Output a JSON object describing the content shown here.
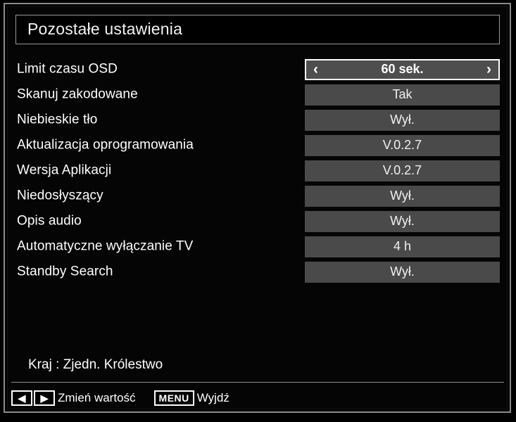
{
  "screen": {
    "title": "Pozostałe ustawienia"
  },
  "settings": {
    "rows": [
      {
        "label": "Limit czasu OSD",
        "value": "60 sek.",
        "selected": true
      },
      {
        "label": "Skanuj zakodowane",
        "value": "Tak",
        "selected": false
      },
      {
        "label": "Niebieskie tło",
        "value": "Wył.",
        "selected": false
      },
      {
        "label": "Aktualizacja oprogramowania",
        "value": "V.0.2.7",
        "selected": false
      },
      {
        "label": "Wersja Aplikacji",
        "value": "V.0.2.7",
        "selected": false
      },
      {
        "label": "Niedosłyszący",
        "value": "Wył.",
        "selected": false
      },
      {
        "label": "Opis audio",
        "value": "Wył.",
        "selected": false
      },
      {
        "label": "Automatyczne wyłączanie TV",
        "value": "4 h",
        "selected": false
      },
      {
        "label": "Standby Search",
        "value": "Wył.",
        "selected": false
      }
    ],
    "left_arrow_glyph": "‹",
    "right_arrow_glyph": "›"
  },
  "footer": {
    "country_line": "Kraj : Zjedn. Królestwo",
    "actions": [
      {
        "keys": [
          "◀",
          "▶"
        ],
        "key_style": "arrow",
        "label": "Zmień wartość"
      },
      {
        "keys": [
          "MENU"
        ],
        "key_style": "menu",
        "label": "Wyjdź"
      }
    ]
  },
  "colors": {
    "background": "#000000",
    "frame_border": "#8a8a8a",
    "value_box": "#4a4a4a",
    "selected_border": "#ffffff",
    "text": "#ffffff"
  }
}
